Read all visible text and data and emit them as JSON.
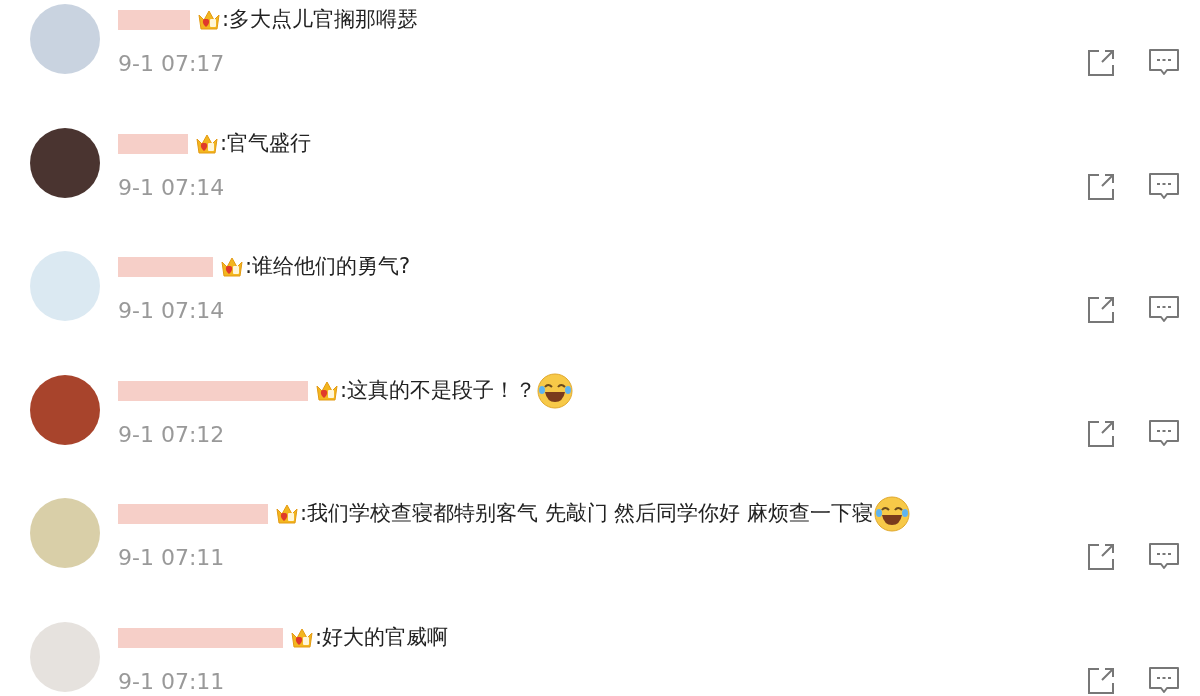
{
  "comments": [
    {
      "text": ":多大点儿官搁那嘚瑟",
      "time": "9-1 07:17",
      "emoji": false
    },
    {
      "text": ":官气盛行",
      "time": "9-1 07:14",
      "emoji": false
    },
    {
      "text": ":谁给他们的勇气?",
      "time": "9-1 07:14",
      "emoji": false
    },
    {
      "text": ":这真的不是段子！？",
      "time": "9-1 07:12",
      "emoji": true
    },
    {
      "text": ":我们学校查寝都特别客气 先敲门 然后同学你好 麻烦查一下寝",
      "time": "9-1 07:11",
      "emoji": true
    },
    {
      "text": ":好大的官威啊",
      "time": "9-1 07:11",
      "emoji": false
    }
  ]
}
